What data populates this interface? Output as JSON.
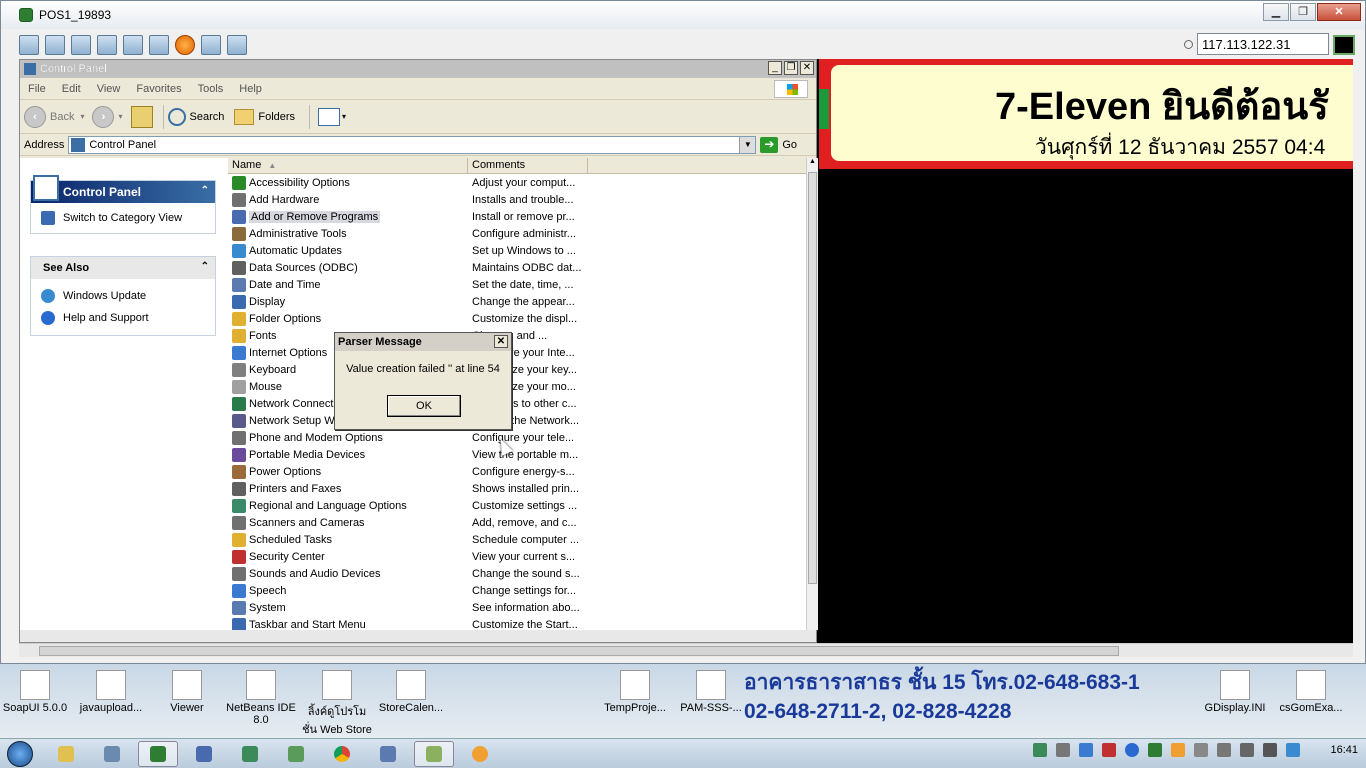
{
  "viewer": {
    "title": "POS1_19893",
    "ip": "117.113.122.31"
  },
  "cp": {
    "title": "Control Panel",
    "menu": [
      "File",
      "Edit",
      "View",
      "Favorites",
      "Tools",
      "Help"
    ],
    "toolbar": {
      "back": "Back",
      "search": "Search",
      "folders": "Folders"
    },
    "address_label": "Address",
    "address_value": "Control Panel",
    "go": "Go",
    "task_pane": {
      "title": "Control Panel",
      "switch": "Switch to Category View",
      "see_also": "See Also",
      "links": [
        "Windows Update",
        "Help and Support"
      ]
    },
    "columns": {
      "name": "Name",
      "comments": "Comments"
    },
    "items": [
      {
        "name": "Accessibility Options",
        "comment": "Adjust your comput...",
        "color": "#2a8a2a"
      },
      {
        "name": "Add Hardware",
        "comment": "Installs and trouble...",
        "color": "#707070"
      },
      {
        "name": "Add or Remove Programs",
        "comment": "Install or remove pr...",
        "color": "#4a6ab0"
      },
      {
        "name": "Administrative Tools",
        "comment": "Configure administr...",
        "color": "#8a6a3a"
      },
      {
        "name": "Automatic Updates",
        "comment": "Set up Windows to ...",
        "color": "#3a8ad0"
      },
      {
        "name": "Data Sources (ODBC)",
        "comment": "Maintains ODBC dat...",
        "color": "#606060"
      },
      {
        "name": "Date and Time",
        "comment": "Set the date, time, ...",
        "color": "#5a7ab0"
      },
      {
        "name": "Display",
        "comment": "Change the appear...",
        "color": "#3a6ab0"
      },
      {
        "name": "Folder Options",
        "comment": "Customize the displ...",
        "color": "#e0b030"
      },
      {
        "name": "Fonts",
        "comment": "Change, and ...",
        "color": "#e0b030"
      },
      {
        "name": "Internet Options",
        "comment": "Configure your Inte...",
        "color": "#3a7ad0"
      },
      {
        "name": "Keyboard",
        "comment": "Customize your key...",
        "color": "#808080"
      },
      {
        "name": "Mouse",
        "comment": "Customize your mo...",
        "color": "#a0a0a0"
      },
      {
        "name": "Network Connections",
        "comment": "Connects to other c...",
        "color": "#2a7a4a"
      },
      {
        "name": "Network Setup Wizard",
        "comment": "Launch the Network...",
        "color": "#5a5a8a"
      },
      {
        "name": "Phone and Modem Options",
        "comment": "Configure your tele...",
        "color": "#707070"
      },
      {
        "name": "Portable Media Devices",
        "comment": "View the portable m...",
        "color": "#6a4a9a"
      },
      {
        "name": "Power Options",
        "comment": "Configure energy-s...",
        "color": "#9a6a3a"
      },
      {
        "name": "Printers and Faxes",
        "comment": "Shows installed prin...",
        "color": "#606060"
      },
      {
        "name": "Regional and Language Options",
        "comment": "Customize settings ...",
        "color": "#3a8a6a"
      },
      {
        "name": "Scanners and Cameras",
        "comment": "Add, remove, and c...",
        "color": "#707070"
      },
      {
        "name": "Scheduled Tasks",
        "comment": "Schedule computer ...",
        "color": "#e0b030"
      },
      {
        "name": "Security Center",
        "comment": "View your current s...",
        "color": "#c03030"
      },
      {
        "name": "Sounds and Audio Devices",
        "comment": "Change the sound s...",
        "color": "#707070"
      },
      {
        "name": "Speech",
        "comment": "Change settings for...",
        "color": "#3a7ad0"
      },
      {
        "name": "System",
        "comment": "See information abo...",
        "color": "#5a7ab0"
      },
      {
        "name": "Taskbar and Start Menu",
        "comment": "Customize the Start...",
        "color": "#3a6ab0"
      }
    ]
  },
  "dialog": {
    "title": "Parser Message",
    "message": "Value creation failed '' at line 54",
    "ok": "OK"
  },
  "seven": {
    "title": "7-Eleven ยินดีต้อนรั",
    "date": "วันศุกร์ที่ 12 ธันวาคม 2557 04:4"
  },
  "desktop": {
    "icons": [
      {
        "label": "SoapUI 5.0.0"
      },
      {
        "label": "javaupload..."
      },
      {
        "label": "Viewer"
      },
      {
        "label": "NetBeans IDE 8.0"
      },
      {
        "label": "ลิ้งค์ดูโปรโมชั่น Web Store ..."
      },
      {
        "label": "StoreCalen..."
      },
      {
        "label": "TempProje..."
      },
      {
        "label": "PAM-SSS-..."
      },
      {
        "label": "GDisplay.INI"
      },
      {
        "label": "csGomExa..."
      }
    ],
    "banner_line1": "อาคารธาราสาธร ชั้น 15 โทร.02-648-683-1",
    "banner_line2": "02-648-2711-2, 02-828-4228"
  },
  "taskbar": {
    "clock": "16:41"
  }
}
